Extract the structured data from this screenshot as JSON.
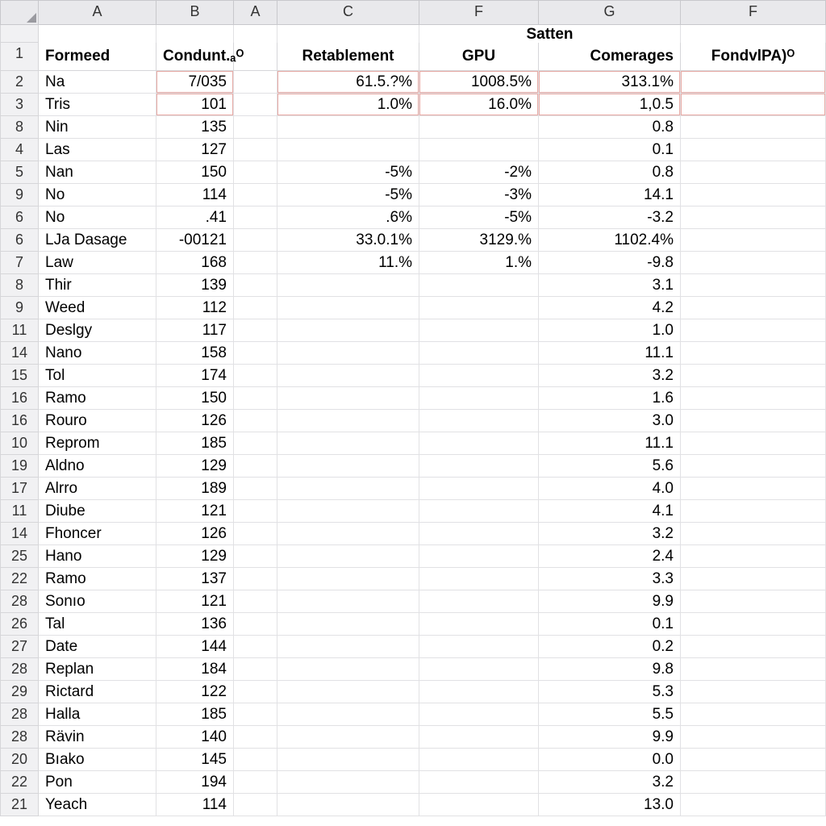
{
  "columnLetters": [
    "A",
    "B",
    "A",
    "C",
    "F",
    "G",
    "F"
  ],
  "superHeader": "Satten",
  "headers": {
    "a": "Formeed",
    "b": "Condunt.ₐᴼ",
    "c": "Retablement",
    "f1": "GPU",
    "g": "Comerages",
    "f2": "FondvlPA)ᴼ"
  },
  "rows": [
    {
      "num": "2",
      "a": "Na",
      "b": "7/035",
      "c": "61.5.?%",
      "f1": "1008.5%",
      "g": "313.1%",
      "hl": true
    },
    {
      "num": "3",
      "a": "Tris",
      "b": "101",
      "c": "1.0%",
      "f1": "16.0%",
      "g": "1,0.5",
      "hl": true
    },
    {
      "num": "8",
      "a": "Nin",
      "b": "135",
      "c": "",
      "f1": "",
      "g": "0.8"
    },
    {
      "num": "4",
      "a": "Las",
      "b": "127",
      "c": "",
      "f1": "",
      "g": "0.1"
    },
    {
      "num": "5",
      "a": "Nan",
      "b": "150",
      "c": "-5%",
      "f1": "-2%",
      "g": "0.8"
    },
    {
      "num": "9",
      "a": "No",
      "b": "114",
      "c": "-5%",
      "f1": "-3%",
      "g": "14.1"
    },
    {
      "num": "6",
      "a": "No",
      "b": ".41",
      "c": ".6%",
      "f1": "-5%",
      "g": "-3.2"
    },
    {
      "num": "6",
      "a": "LJa Dasage",
      "b": "-00121",
      "c": "33.0.1%",
      "f1": "3129.%",
      "g": "1102.4%"
    },
    {
      "num": "7",
      "a": "Law",
      "b": "168",
      "c": "11.%",
      "f1": "1.%",
      "g": "-9.8"
    },
    {
      "num": "8",
      "a": "Thir",
      "b": "139",
      "c": "",
      "f1": "",
      "g": "3.1"
    },
    {
      "num": "9",
      "a": "Weed",
      "b": "112",
      "c": "",
      "f1": "",
      "g": "4.2"
    },
    {
      "num": "11",
      "a": "Deslgy",
      "b": "117",
      "c": "",
      "f1": "",
      "g": "1.0"
    },
    {
      "num": "14",
      "a": "Nano",
      "b": "158",
      "c": "",
      "f1": "",
      "g": "11.1"
    },
    {
      "num": "15",
      "a": "Tol",
      "b": "174",
      "c": "",
      "f1": "",
      "g": "3.2"
    },
    {
      "num": "16",
      "a": "Ramo",
      "b": "150",
      "c": "",
      "f1": "",
      "g": "1.6"
    },
    {
      "num": "16",
      "a": "Rouro",
      "b": "126",
      "c": "",
      "f1": "",
      "g": "3.0"
    },
    {
      "num": "10",
      "a": "Reprom",
      "b": "185",
      "c": "",
      "f1": "",
      "g": "11.1"
    },
    {
      "num": "19",
      "a": "Aldno",
      "b": "129",
      "c": "",
      "f1": "",
      "g": "5.6"
    },
    {
      "num": "17",
      "a": "Alrro",
      "b": "189",
      "c": "",
      "f1": "",
      "g": "4.0"
    },
    {
      "num": "11",
      "a": "Diube",
      "b": "121",
      "c": "",
      "f1": "",
      "g": "4.1"
    },
    {
      "num": "14",
      "a": "Fhoncer",
      "b": "126",
      "c": "",
      "f1": "",
      "g": "3.2"
    },
    {
      "num": "25",
      "a": "Hano",
      "b": "129",
      "c": "",
      "f1": "",
      "g": "2.4"
    },
    {
      "num": "22",
      "a": "Ramo",
      "b": "137",
      "c": "",
      "f1": "",
      "g": "3.3"
    },
    {
      "num": "28",
      "a": "Sonıo",
      "b": "121",
      "c": "",
      "f1": "",
      "g": "9.9"
    },
    {
      "num": "26",
      "a": "Tal",
      "b": "136",
      "c": "",
      "f1": "",
      "g": "0.1"
    },
    {
      "num": "27",
      "a": "Date",
      "b": "144",
      "c": "",
      "f1": "",
      "g": "0.2"
    },
    {
      "num": "28",
      "a": "Replan",
      "b": "184",
      "c": "",
      "f1": "",
      "g": "9.8"
    },
    {
      "num": "29",
      "a": "Rictard",
      "b": "122",
      "c": "",
      "f1": "",
      "g": "5.3"
    },
    {
      "num": "28",
      "a": "Halla",
      "b": "185",
      "c": "",
      "f1": "",
      "g": "5.5"
    },
    {
      "num": "28",
      "a": "Rävin",
      "b": "140",
      "c": "",
      "f1": "",
      "g": "9.9"
    },
    {
      "num": "20",
      "a": "Bıako",
      "b": "145",
      "c": "",
      "f1": "",
      "g": "0.0"
    },
    {
      "num": "22",
      "a": "Pon",
      "b": "194",
      "c": "",
      "f1": "",
      "g": "3.2"
    },
    {
      "num": "21",
      "a": "Yeach",
      "b": "114",
      "c": "",
      "f1": "",
      "g": "13.0"
    }
  ]
}
